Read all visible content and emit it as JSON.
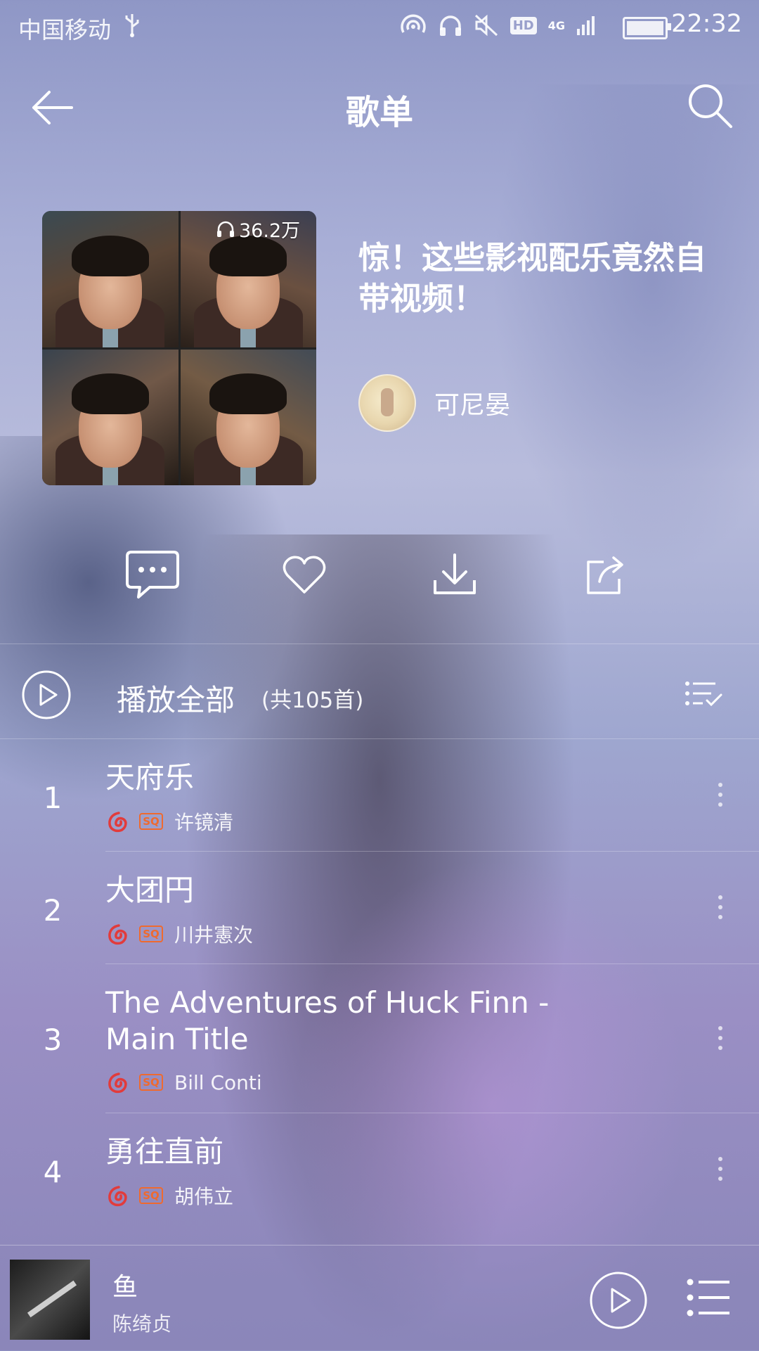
{
  "status_bar": {
    "carrier": "中国移动",
    "hd_label": "HD",
    "network": "4G",
    "time": "22:32"
  },
  "header": {
    "title": "歌单"
  },
  "playlist": {
    "play_count": "36.2万",
    "title": "惊！这些影视配乐竟然自带视频！",
    "creator": "可尼晏"
  },
  "actions": [
    {
      "icon": "comment-icon"
    },
    {
      "icon": "heart-icon"
    },
    {
      "icon": "download-icon"
    },
    {
      "icon": "share-icon"
    }
  ],
  "play_all": {
    "label": "播放全部",
    "count": "(共105首)"
  },
  "songs": [
    {
      "index": "1",
      "title": "天府乐",
      "artist": "许镜清",
      "badge": "SQ"
    },
    {
      "index": "2",
      "title": "大团円",
      "artist": "川井憲次",
      "badge": "SQ"
    },
    {
      "index": "3",
      "title": "The Adventures of Huck Finn - Main Title",
      "artist": "Bill Conti",
      "badge": "SQ"
    },
    {
      "index": "4",
      "title": "勇往直前",
      "artist": "胡伟立",
      "badge": "SQ"
    }
  ],
  "mini_player": {
    "title": "鱼",
    "artist": "陈绮贞"
  },
  "colors": {
    "accent_red": "#e23b3b",
    "badge_orange": "#ef6a2e"
  }
}
